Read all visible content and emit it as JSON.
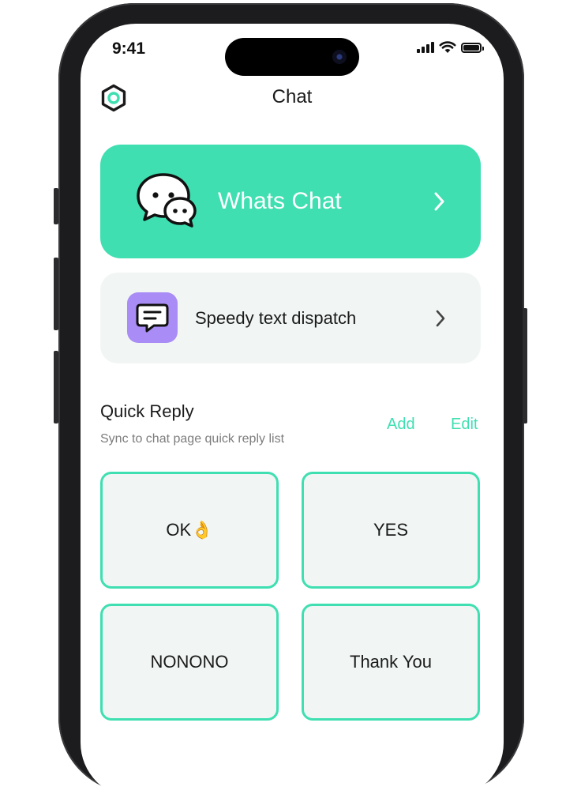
{
  "status_bar": {
    "time": "9:41",
    "battery_level": 1.0
  },
  "header": {
    "title": "Chat",
    "left_icon": "hexagon-settings-icon"
  },
  "whats_chat": {
    "label": "Whats Chat",
    "icon": "chat-bubbles-icon",
    "color": "#3fdfb1"
  },
  "speedy": {
    "label": "Speedy text dispatch",
    "icon": "message-icon",
    "icon_bg": "#a98cf5"
  },
  "quick_reply": {
    "title": "Quick Reply",
    "subtitle": "Sync to chat page quick reply list",
    "add_label": "Add",
    "edit_label": "Edit",
    "items": [
      "OK👌",
      "YES",
      "NONONO",
      "Thank You"
    ]
  }
}
